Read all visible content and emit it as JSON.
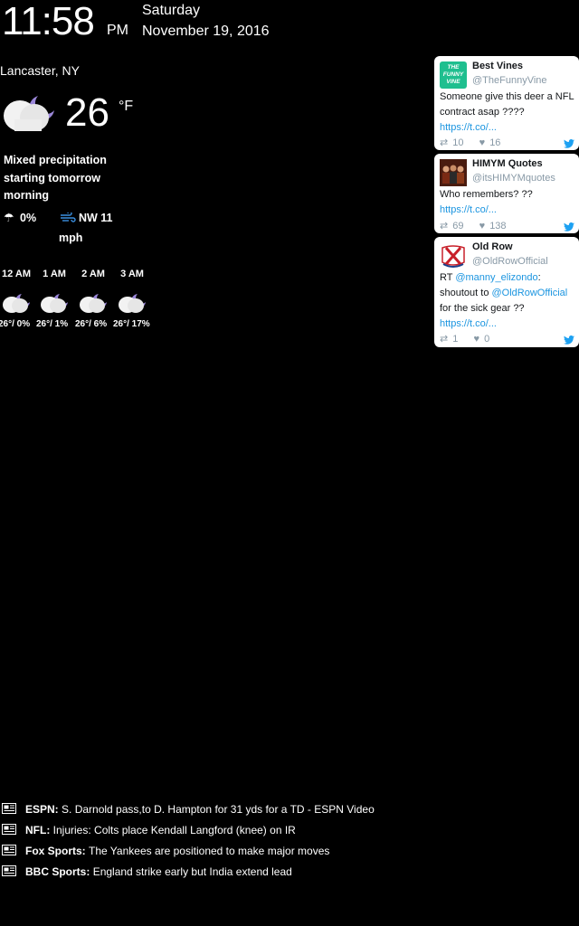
{
  "clock": {
    "time": "11:58",
    "ampm": "PM",
    "day": "Saturday",
    "date": "November 19, 2016"
  },
  "weather": {
    "location": "Lancaster, NY",
    "temperature": "26",
    "unit": "°F",
    "icon": "partly-cloudy-night-icon",
    "summary": "Mixed precipitation starting tomorrow morning",
    "precip": "0%",
    "wind": "NW 11",
    "wind_unit": "mph",
    "hourly": [
      {
        "hour": "12 AM",
        "value": "26°/ 0%"
      },
      {
        "hour": "1 AM",
        "value": "26°/ 1%"
      },
      {
        "hour": "2 AM",
        "value": "26°/ 6%"
      },
      {
        "hour": "3 AM",
        "value": "26°/ 17%"
      }
    ]
  },
  "tweets": [
    {
      "name": "Best Vines",
      "handle": "@TheFunnyVine",
      "text": "Someone give this deer a NFL contract asap ????",
      "link": "https://t.co/...",
      "retweets": "10",
      "likes": "16"
    },
    {
      "name": "HIMYM Quotes",
      "handle": "@itsHIMYMquotes",
      "text": "Who remembers? ??",
      "link": "https://t.co/...",
      "retweets": "69",
      "likes": "138"
    },
    {
      "name": "Old Row",
      "handle": "@OldRowOfficial",
      "text_prefix": "RT ",
      "mention1": "@manny_elizondo",
      "text_mid": ": shoutout to ",
      "mention2": "@OldRowOfficial",
      "text_suffix": " for the sick gear ??",
      "link": "https://t.co/...",
      "retweets": "1",
      "likes": "0"
    }
  ],
  "avatars": {
    "funny_vine_line1": "THE",
    "funny_vine_line2": "FUNNY",
    "funny_vine_line3": "VINE"
  },
  "news": [
    {
      "source": "ESPN:",
      "headline": "S. Darnold pass,to D. Hampton for 31 yds for a TD - ESPN Video"
    },
    {
      "source": "NFL:",
      "headline": "Injuries: Colts place Kendall Langford (knee) on IR"
    },
    {
      "source": "Fox Sports:",
      "headline": "The Yankees are positioned to make major moves"
    },
    {
      "source": "BBC Sports:",
      "headline": "England strike early but India extend lead"
    }
  ],
  "colors": {
    "background": "#000000",
    "moon": "#9b87d9",
    "twitter_blue": "#1da1f2",
    "link_blue": "#1b95e0",
    "vine_green": "#1fbf8f"
  }
}
